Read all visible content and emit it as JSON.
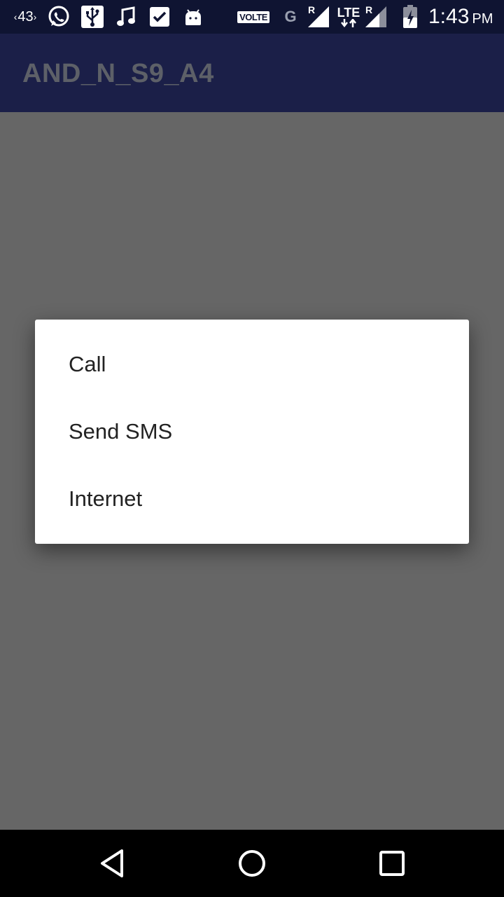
{
  "status_bar": {
    "notification_count": "43",
    "network_type": "G",
    "volte": "VOLTE",
    "lte": "LTE",
    "roaming_1": "R",
    "roaming_2": "R",
    "time": "1:43",
    "ampm": "PM",
    "icons": [
      "whatsapp-icon",
      "usb-icon",
      "music-note-icon",
      "checkbox-icon",
      "android-icon",
      "signal-icon",
      "lte-icon",
      "signal-icon",
      "battery-charging-icon"
    ]
  },
  "toolbar": {
    "title": "AND_N_S9_A4"
  },
  "dialog": {
    "items": [
      {
        "label": "Call"
      },
      {
        "label": "Send SMS"
      },
      {
        "label": "Internet"
      }
    ]
  },
  "navigation": {
    "icons": [
      "back-icon",
      "home-icon",
      "recents-icon"
    ]
  },
  "colors": {
    "status_bar_bg": "#0f1432",
    "toolbar_bg": "#1b1f48",
    "scrim": "#666666",
    "dialog_bg": "#ffffff",
    "nav_bar_bg": "#000000"
  }
}
